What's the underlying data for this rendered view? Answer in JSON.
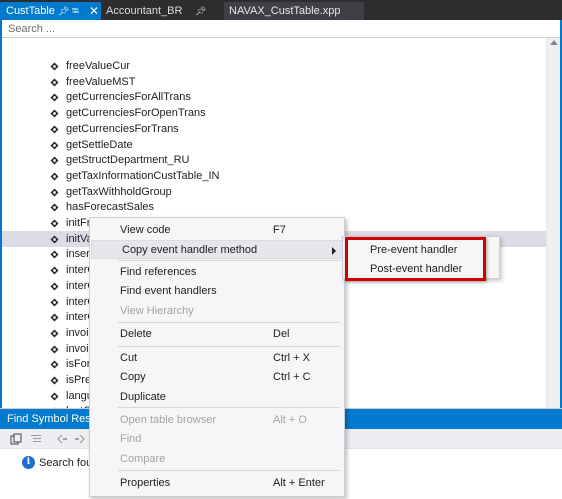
{
  "tabs": [
    {
      "label": "CustTable",
      "active": true
    },
    {
      "label": "Accountant_BR",
      "active": false
    },
    {
      "label": "NAVAX_CustTable.xpp",
      "active": false
    }
  ],
  "search": {
    "placeholder": "Search ..."
  },
  "tree": {
    "items": [
      "freeValueCur",
      "freeValueMST",
      "getCurrenciesForAllTrans",
      "getCurrenciesForOpenTrans",
      "getCurrenciesForTrans",
      "getSettleDate",
      "getStructDepartment_RU",
      "getTaxInformationCustTable_IN",
      "getTaxWithholdGroup",
      "hasForecastSales",
      "initFromCustGroup",
      "initVa",
      "insert",
      "interC",
      "interC",
      "interC",
      "interC",
      "invoi",
      "invoi",
      "isFore",
      "isPref",
      "langu",
      "lastC"
    ],
    "selected_index": 11
  },
  "find_panel": {
    "title": "Find Symbol Resu",
    "result_text": "Search fou"
  },
  "context_menu": {
    "items": [
      {
        "label": "View code",
        "shortcut": "F7",
        "enabled": true
      },
      {
        "label": "Copy event handler method",
        "shortcut": "",
        "enabled": true,
        "submenu": true,
        "highlighted": true
      },
      {
        "label": "Find references",
        "shortcut": "",
        "enabled": true
      },
      {
        "label": "Find event handlers",
        "shortcut": "",
        "enabled": true
      },
      {
        "label": "View Hierarchy",
        "shortcut": "",
        "enabled": false
      },
      {
        "label": "Delete",
        "shortcut": "Del",
        "enabled": true
      },
      {
        "label": "Cut",
        "shortcut": "Ctrl + X",
        "enabled": true
      },
      {
        "label": "Copy",
        "shortcut": "Ctrl + C",
        "enabled": true
      },
      {
        "label": "Duplicate",
        "shortcut": "",
        "enabled": true
      },
      {
        "label": "Open table browser",
        "shortcut": "Alt + O",
        "enabled": false
      },
      {
        "label": "Find",
        "shortcut": "",
        "enabled": false
      },
      {
        "label": "Compare",
        "shortcut": "",
        "enabled": false
      },
      {
        "label": "Properties",
        "shortcut": "Alt + Enter",
        "enabled": true
      }
    ]
  },
  "submenu": {
    "items": [
      "Pre-event handler",
      "Post-event handler"
    ]
  },
  "colors": {
    "accent": "#007acc",
    "annotation_box": "#d40000",
    "selection": "#dcdce6",
    "disabled_text": "#a2a4a5"
  },
  "icons": {
    "method": "method-icon",
    "pin": "pin-icon",
    "close": "close-icon",
    "info": "info-icon",
    "submenu_arrow": "chevron-right-icon"
  }
}
